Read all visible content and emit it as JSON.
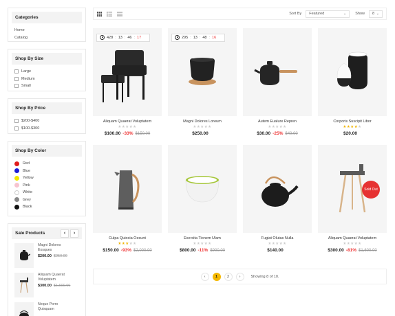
{
  "categories": {
    "title": "Categories",
    "items": [
      "Home",
      "Catalog"
    ]
  },
  "size": {
    "title": "Shop By Size",
    "items": [
      "Large",
      "Medium",
      "Small"
    ]
  },
  "price_filter": {
    "title": "Shop By Price",
    "items": [
      "$200-$400",
      "$100-$300"
    ]
  },
  "color_filter": {
    "title": "Shop By Color",
    "items": [
      {
        "label": "Red",
        "color": "#e01b1b"
      },
      {
        "label": "Blue",
        "color": "#1b1bd6"
      },
      {
        "label": "Yellow",
        "color": "#f2e600"
      },
      {
        "label": "Pink",
        "color": "#f7c4d0"
      },
      {
        "label": "White",
        "color": "#ffffff"
      },
      {
        "label": "Grey",
        "color": "#888888"
      },
      {
        "label": "Black",
        "color": "#111111"
      }
    ]
  },
  "sale": {
    "title": "Sale Products",
    "prev": "‹",
    "next": "›",
    "items": [
      {
        "name_1": "Magni Dolores",
        "name_2": "Eosques",
        "price": "$200.00",
        "old": "$250.00"
      },
      {
        "name_1": "Aliquam Quaerat",
        "name_2": "Voluptatem",
        "price": "$300.00",
        "old": "$1,600.00"
      },
      {
        "name_1": "Neque Porro",
        "name_2": "Quisquam",
        "price": "",
        "old": ""
      }
    ]
  },
  "toolbar": {
    "sort_label": "Sort By",
    "sort_value": "Featured",
    "show_label": "Show",
    "show_value": "8"
  },
  "products": [
    {
      "name": "Aliquam Quaerat Voluptatem",
      "price": "$100.00",
      "discount": "-33%",
      "old": "$150.00",
      "rating": 0,
      "timer": {
        "days": "428",
        "hours": "13",
        "minutes": "46",
        "seconds": "17"
      }
    },
    {
      "name": "Magni Dolores Loreum",
      "price": "$250.00",
      "discount": "",
      "old": "",
      "rating": 0,
      "timer": {
        "days": "295",
        "hours": "13",
        "minutes": "48",
        "seconds": "16"
      }
    },
    {
      "name": "Autem Eualure Repren",
      "price": "$30.00",
      "discount": "-25%",
      "old": "$40.00",
      "rating": 0
    },
    {
      "name": "Corporis Suscipit Libor",
      "price": "$20.00",
      "discount": "",
      "old": "",
      "rating": 4
    },
    {
      "name": "Culpa Quiocia Oesunt",
      "price": "$150.00",
      "discount": "-93%",
      "old": "$2,000.00",
      "rating": 3
    },
    {
      "name": "Exercita Tionem Ulam",
      "price": "$800.00",
      "discount": "-11%",
      "old": "$900.00",
      "rating": 0
    },
    {
      "name": "Fugiat Olutas Nulla",
      "price": "$140.00",
      "discount": "",
      "old": "",
      "rating": 0
    },
    {
      "name": "Aliquam Quaerat Voluptatem",
      "price": "$300.00",
      "discount": "-81%",
      "old": "$1,600.00",
      "rating": 0,
      "badge": "Sold Out"
    }
  ],
  "pagination": {
    "prev": "‹",
    "pages": [
      "1",
      "2"
    ],
    "next": "›",
    "showing": "Showing 8 of 10."
  },
  "colors": {
    "accent": "#f5b800",
    "discount": "#e33333",
    "sold_out": "#e63232",
    "star": "#f0b400"
  }
}
